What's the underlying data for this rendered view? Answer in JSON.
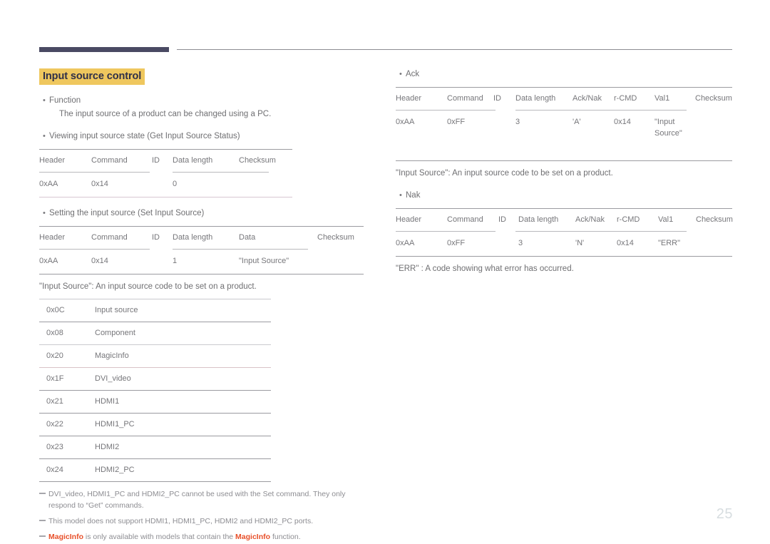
{
  "page": {
    "number": "25",
    "section_title": "Input source control"
  },
  "left": {
    "function_bullet": "Function",
    "function_desc": "The input source of a product can be changed using a PC.",
    "get_bullet": "Viewing input source state (Get Input Source Status)",
    "get_table": {
      "headers": [
        "Header",
        "Command",
        "ID",
        "Data length",
        "Checksum"
      ],
      "row": [
        "0xAA",
        "0x14",
        "",
        "0",
        ""
      ]
    },
    "set_bullet": "Setting the input source (Set Input Source)",
    "set_table": {
      "headers": [
        "Header",
        "Command",
        "ID",
        "Data length",
        "Data",
        "Checksum"
      ],
      "row": [
        "0xAA",
        "0x14",
        "",
        "1",
        "\"Input Source\"",
        ""
      ]
    },
    "caption": "\"Input Source\": An input source code to be set on a product.",
    "code_table": {
      "rows": [
        {
          "code": "0x0C",
          "name": "Input source"
        },
        {
          "code": "0x08",
          "name": "Component"
        },
        {
          "code": "0x20",
          "name": "MagicInfo"
        },
        {
          "code": "0x1F",
          "name": "DVI_video"
        },
        {
          "code": "0x21",
          "name": "HDMI1"
        },
        {
          "code": "0x22",
          "name": "HDMI1_PC"
        },
        {
          "code": "0x23",
          "name": "HDMI2"
        },
        {
          "code": "0x24",
          "name": "HDMI2_PC"
        }
      ]
    },
    "footnotes": [
      "DVI_video, HDMI1_PC and HDMI2_PC cannot be used with the Set command. They only respond to “Get” commands.",
      "This model does not support HDMI1, HDMI1_PC, HDMI2 and HDMI2_PC ports."
    ],
    "footnote_magic": {
      "word": "MagicInfo",
      "mid": " is only available with models that contain the ",
      "end": " function."
    }
  },
  "right": {
    "ack_bullet": "Ack",
    "ack_table": {
      "headers": [
        "Header",
        "Command",
        "ID",
        "Data length",
        "Ack/Nak",
        "r-CMD",
        "Val1",
        "Checksum"
      ],
      "row": [
        "0xAA",
        "0xFF",
        "",
        "3",
        "'A'",
        "0x14",
        "\"Input Source\"",
        ""
      ]
    },
    "ack_caption": "\"Input Source\": An input source code to be set on a product.",
    "nak_bullet": "Nak",
    "nak_table": {
      "headers": [
        "Header",
        "Command",
        "ID",
        "Data length",
        "Ack/Nak",
        "r-CMD",
        "Val1",
        "Checksum"
      ],
      "row": [
        "0xAA",
        "0xFF",
        "",
        "3",
        "'N'",
        "0x14",
        "\"ERR\"",
        ""
      ]
    },
    "nak_caption": "\"ERR\" : A code showing what error has occurred."
  },
  "symbols": {
    "bullet": "•"
  },
  "colors": {
    "title_highlight": "#efc75e",
    "title_text": "#2f2f48",
    "header_bar": "#4a4a63",
    "accent_orange": "#e8502a",
    "body_text": "#6f6f72"
  }
}
